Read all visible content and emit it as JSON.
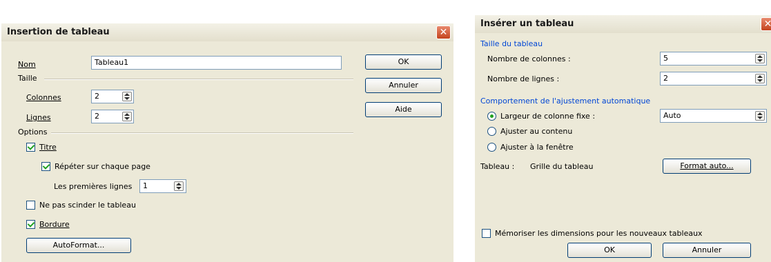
{
  "dialog1": {
    "title": "Insertion de tableau",
    "close_glyph": "✕",
    "name_label": "Nom",
    "name_value": "Tableau1",
    "size_section": "Taille",
    "columns_label": "Colonnes",
    "columns_value": "2",
    "rows_label": "Lignes",
    "rows_value": "2",
    "options_section": "Options",
    "title_checkbox": "Titre",
    "repeat_checkbox": "Répéter sur chaque page",
    "first_rows_label": "Les premières lignes",
    "first_rows_value": "1",
    "no_split_checkbox": "Ne pas scinder le tableau",
    "border_checkbox": "Bordure",
    "autoformat_button": "AutoFormat...",
    "ok_button": "OK",
    "cancel_button": "Annuler",
    "help_button": "Aide"
  },
  "dialog2": {
    "title": "Insérer un tableau",
    "close_glyph": "✕",
    "size_section": "Taille du tableau",
    "columns_label": "Nombre de colonnes :",
    "columns_value": "5",
    "rows_label": "Nombre de lignes :",
    "rows_value": "2",
    "autofit_section": "Comportement de l'ajustement automatique",
    "fixed_width_label": "Largeur de colonne fixe :",
    "fixed_width_value": "Auto",
    "fit_content_label": "Ajuster au contenu",
    "fit_window_label": "Ajuster à la fenêtre",
    "table_style_label": "Tableau :",
    "table_style_value": "Grille du tableau",
    "autoformat_button": "Format auto...",
    "remember_checkbox": "Mémoriser les dimensions pour les nouveaux tableaux",
    "ok_button": "OK",
    "cancel_button": "Annuler"
  },
  "colors": {
    "dialog_bg": "#ECE9D8",
    "close_red": "#c4431d",
    "section_blue": "#0046d5"
  }
}
